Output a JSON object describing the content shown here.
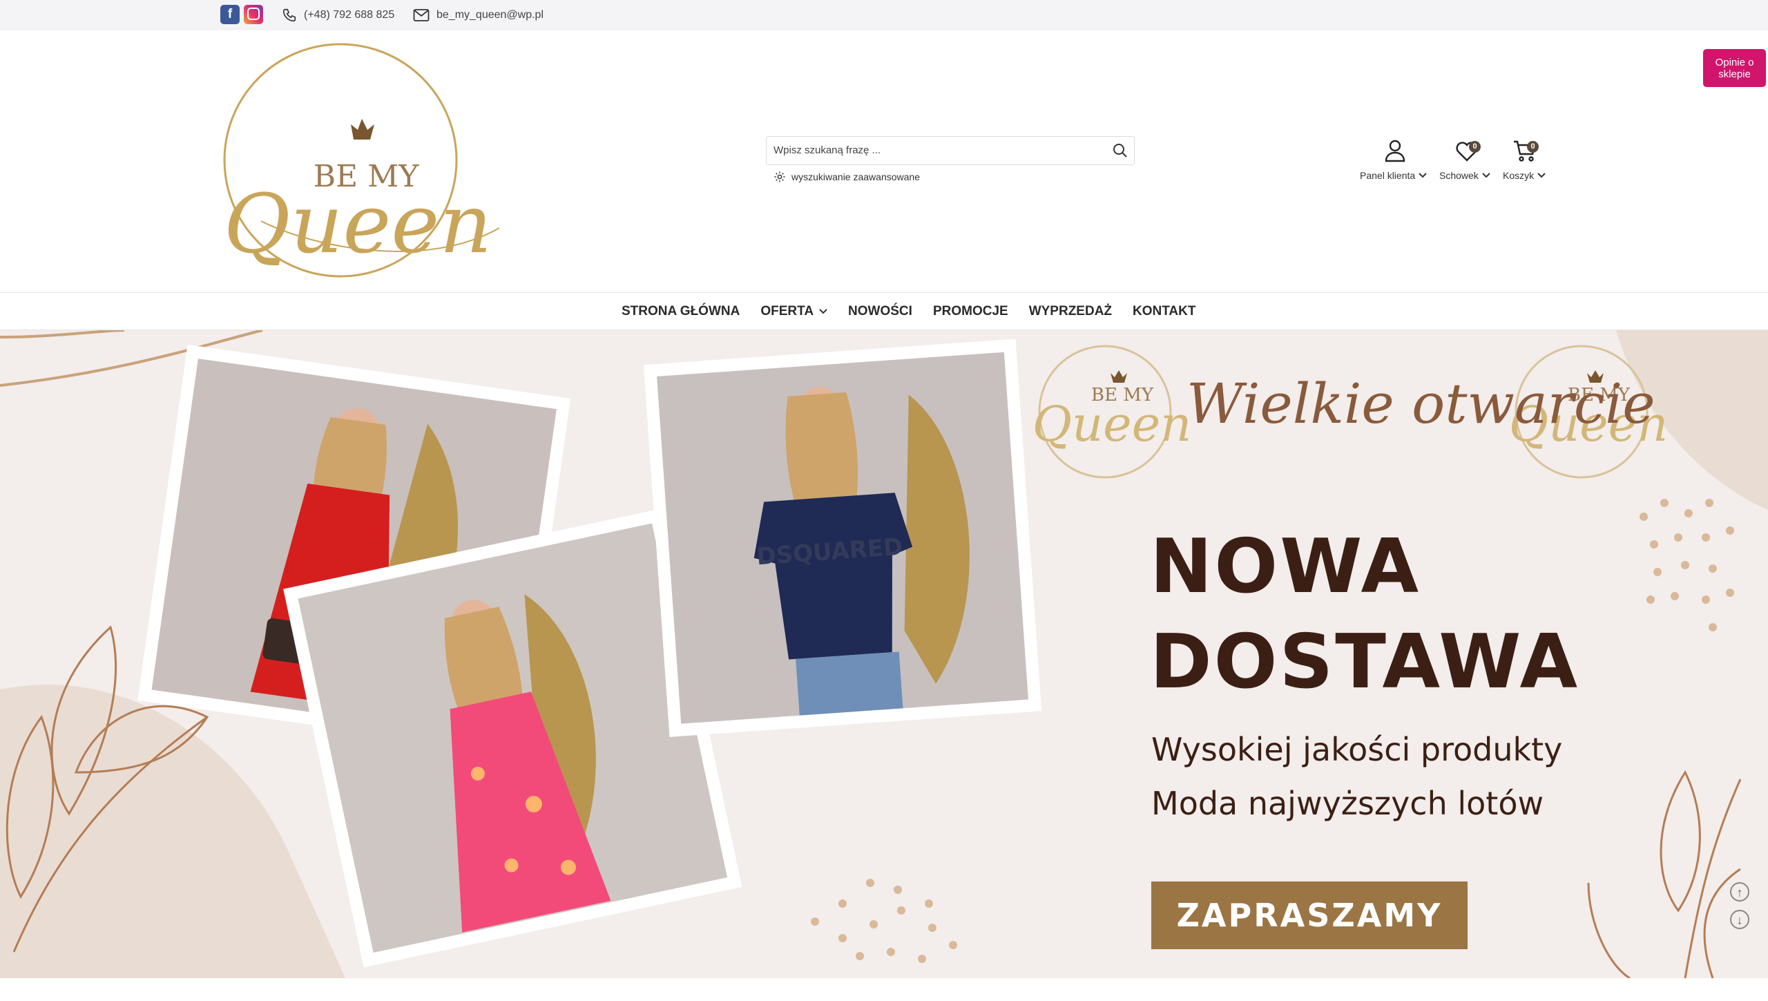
{
  "topbar": {
    "facebook": "f",
    "phone": "(+48) 792 688 825",
    "email": "be_my_queen@wp.pl"
  },
  "logo": {
    "line1": "BE MY",
    "line2": "Queen"
  },
  "search": {
    "placeholder": "Wpisz szukaną frazę ...",
    "advanced": "wyszukiwanie zaawansowane"
  },
  "header_icons": {
    "panel": "Panel klienta",
    "wishlist": "Schowek",
    "wishlist_count": "0",
    "cart": "Koszyk",
    "cart_count": "0"
  },
  "opinie": "Opinie o sklepie",
  "nav": {
    "items": [
      "STRONA GŁÓWNA",
      "OFERTA",
      "NOWOŚCI",
      "PROMOCJE",
      "WYPRZEDAŻ",
      "KONTAKT"
    ]
  },
  "banner": {
    "script_title": "Wielkie otwarcie",
    "badge_line1": "BE MY",
    "badge_line2": "Queen",
    "headline1": "NOWA",
    "headline2": "DOSTAWA",
    "sub1": "Wysokiej jakości produkty",
    "sub2": "Moda najwyższych lotów",
    "cta": "ZAPRASZAMY",
    "tshirt_text": "DSQUARED"
  },
  "colors": {
    "accent": "#d1146c",
    "gold": "#9b7543",
    "brown": "#3c1f14",
    "banner_bg": "#f3edeb"
  }
}
